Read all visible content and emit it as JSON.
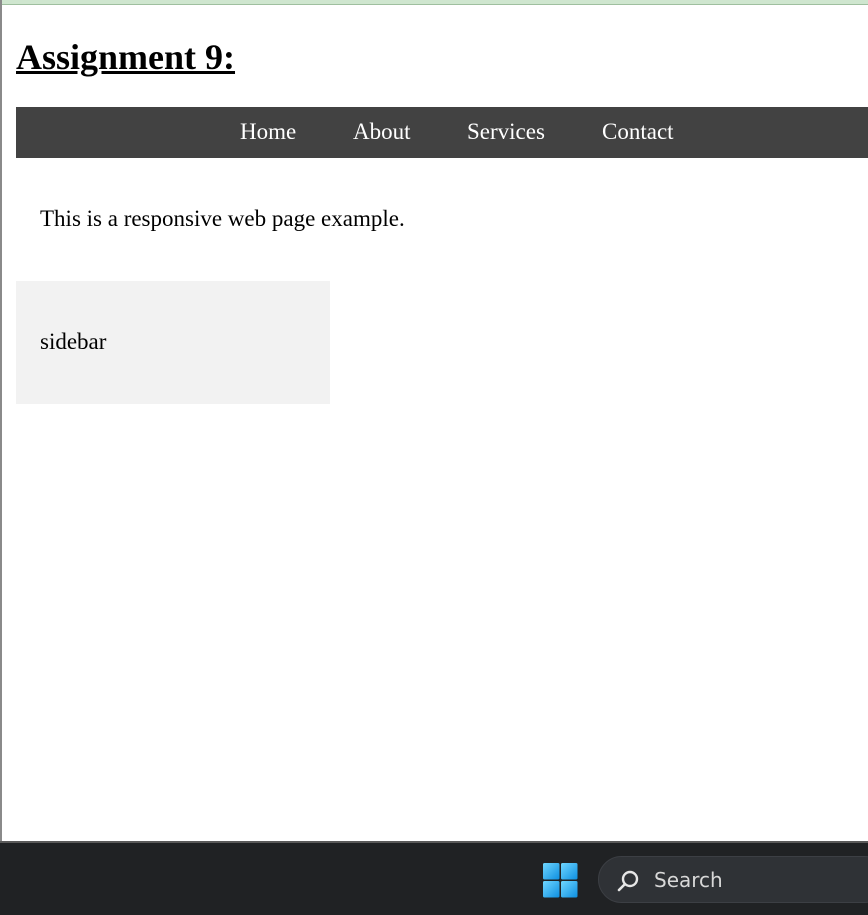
{
  "page": {
    "title": "Assignment 9:",
    "content_text": "This is a responsive web page example.",
    "sidebar_label": "sidebar"
  },
  "nav": {
    "items": [
      {
        "label": "Home"
      },
      {
        "label": "About"
      },
      {
        "label": "Services"
      },
      {
        "label": "Contact"
      }
    ]
  },
  "taskbar": {
    "start_icon": "windows-logo-icon",
    "search": {
      "icon": "search-icon",
      "placeholder": "Search"
    }
  },
  "colors": {
    "nav_background": "#424242",
    "nav_text": "#ffffff",
    "sidebar_background": "#f2f2f2",
    "taskbar_background": "#202224",
    "windows_logo": "#2eb6f5"
  }
}
